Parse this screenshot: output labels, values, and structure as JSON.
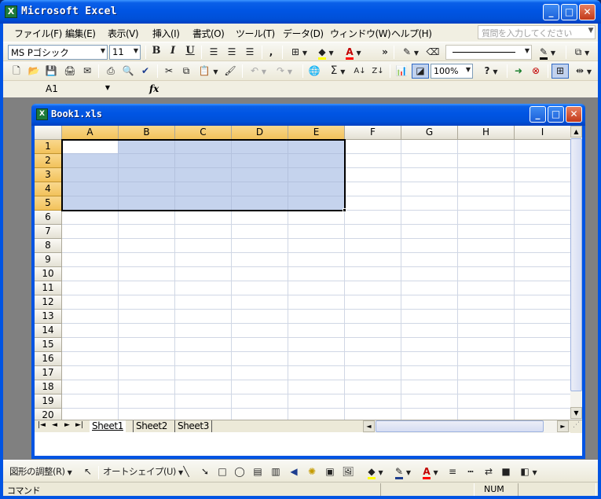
{
  "app": {
    "title": "Microsoft Excel",
    "icon": "excel-app-icon",
    "caption_buttons": [
      "minimize",
      "maximize",
      "close"
    ]
  },
  "menubar": {
    "items": [
      "ファイル(F)",
      "編集(E)",
      "表示(V)",
      "挿入(I)",
      "書式(O)",
      "ツール(T)",
      "データ(D)",
      "ウィンドウ(W)",
      "ヘルプ(H)"
    ],
    "help_placeholder": "質問を入力してください"
  },
  "format_toolbar": {
    "font": "MS Pゴシック",
    "size": "11",
    "bold": "B",
    "italic": "I",
    "underline": "U",
    "comma_style": ",",
    "icons": [
      "align-left-icon",
      "align-center-icon",
      "align-right-icon",
      "borders-icon",
      "fill-color-icon",
      "font-color-icon",
      "pen-icon",
      "eraser-icon",
      "line-style-icon",
      "line-color-icon",
      "copy-format-icon"
    ],
    "font_color_letter": "A"
  },
  "standard_toolbar": {
    "zoom": "100%",
    "sum_symbol": "Σ",
    "icons": [
      "new-icon",
      "open-icon",
      "save-icon",
      "permission-icon",
      "email-icon",
      "print-icon",
      "print-preview-icon",
      "spelling-icon",
      "cut-icon",
      "copy-icon",
      "paste-icon",
      "format-painter-icon",
      "undo-icon",
      "redo-icon",
      "hyperlink-icon",
      "autosum-icon",
      "sort-ascending-icon",
      "sort-descending-icon",
      "chart-wizard-icon",
      "drawing-icon",
      "help-icon",
      "trace-precedents-icon",
      "remove-arrows-icon",
      "show-grid-icon",
      "column-icon"
    ]
  },
  "formula_bar": {
    "name_box": "A1",
    "fx_label": "fx",
    "content": ""
  },
  "workbook": {
    "title": "Book1.xls",
    "columns": [
      "A",
      "B",
      "C",
      "D",
      "E",
      "F",
      "G",
      "H",
      "I"
    ],
    "rows": [
      "1",
      "2",
      "3",
      "4",
      "5",
      "6",
      "7",
      "8",
      "9",
      "10",
      "11",
      "12",
      "13",
      "14",
      "15",
      "16",
      "17",
      "18",
      "19",
      "20"
    ],
    "active_cell": "A1",
    "selection": "A1:E5",
    "tabs": [
      "Sheet1",
      "Sheet2",
      "Sheet3"
    ],
    "active_tab": "Sheet1"
  },
  "drawing_toolbar": {
    "draw_menu": "図形の調整(R)",
    "autoshapes": "オートシェイプ(U)",
    "font_color_letter": "A"
  },
  "status": {
    "left": "コマンド",
    "num": "NUM"
  },
  "colors": {
    "title_blue": "#0054e3",
    "selection_fill": "#c5d3ed",
    "header_selected": "#f2c25a",
    "chrome": "#ece9d8"
  }
}
